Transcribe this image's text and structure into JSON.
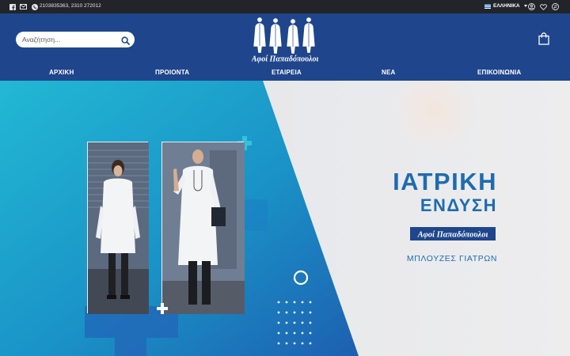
{
  "topbar": {
    "phones": "2103835363, 2310 272012",
    "language": "ΕΛΛΗΝΙΚΑ",
    "icons": [
      "facebook-icon",
      "mail-icon",
      "phone-icon",
      "user-icon",
      "heart-icon",
      "compare-icon"
    ]
  },
  "header": {
    "search_placeholder": "Αναζήτηση...",
    "logo_text": "Αφοί Παπαδόπουλοι"
  },
  "nav": {
    "items": [
      "ΑΡΧΙΚΗ",
      "ΠΡΟΙΟΝΤΑ",
      "ΕΤΑΙΡΕΙΑ",
      "ΝΕΑ",
      "ΕΠΙΚΟΙΝΩΝΙΑ"
    ]
  },
  "hero": {
    "title_line1": "ΙΑΤΡΙΚΗ",
    "title_line2": "ΕΝΔΥΣΗ",
    "brand_label": "Αφοί Παπαδόπουλοι",
    "subtitle": "ΜΠΛΟΥΖΕΣ ΓΙΑΤΡΩΝ"
  },
  "colors": {
    "topbar": "#222429",
    "header": "#1f468c",
    "accent": "#1f6bb0",
    "hero_cyan": "#1aa6c9",
    "hero_grey": "#e4e6ea"
  }
}
